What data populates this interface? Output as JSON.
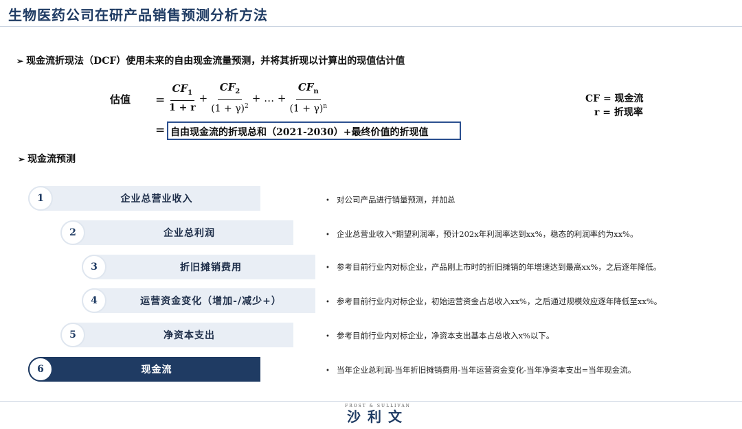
{
  "title": "生物医药公司在研产品销售预测分析方法",
  "bullets": {
    "dcf": "现金流折现法（DCF）使用未来的自由现金流量预测，并将其折现以计算出的现值估计值",
    "forecast": "现金流预测",
    "arrow": "➢"
  },
  "formula": {
    "label": "估值",
    "eq": "=",
    "t1_num": "CF",
    "t1_sub": "1",
    "t1_den": "1 + r",
    "plus": "+",
    "t2_num": "CF",
    "t2_sub": "2",
    "t2_den": "(1 + γ)",
    "t2_exp": "2",
    "ellipsis": "+ … +",
    "tn_num": "CF",
    "tn_sub": "n",
    "tn_den": "(1 + γ)",
    "tn_exp": "n",
    "boxed": "自由现金流的折现总和（2021-2030）+最终价值的折现值"
  },
  "legend": {
    "cf": "CF = 现金流",
    "r": "r = 折现率"
  },
  "steps": [
    {
      "num": "1",
      "label": "企业总营业收入",
      "desc": "对公司产品进行销量预测，并加总"
    },
    {
      "num": "2",
      "label": "企业总利润",
      "desc": "企业总营业收入*期望利润率，预计202x年利润率达到xx%，稳态的利润率约为xx%。"
    },
    {
      "num": "3",
      "label": "折旧摊销费用",
      "desc": "参考目前行业内对标企业，产品刚上市时的折旧摊销的年增速达到最高xx%，之后逐年降低。"
    },
    {
      "num": "4",
      "label": "运营资金变化（增加-/减少+）",
      "desc": "参考目前行业内对标企业，初始运营资金占总收入xx%，之后通过规模效应逐年降低至xx%。"
    },
    {
      "num": "5",
      "label": "净资本支出",
      "desc": "参考目前行业内对标企业，净资本支出基本占总收入x%以下。"
    },
    {
      "num": "6",
      "label": "现金流",
      "desc": "当年企业总利润-当年折旧摊销费用-当年运营资金变化-当年净资本支出=当年现金流。"
    }
  ],
  "bullet_dot": "•",
  "logo": {
    "en": "FROST & SULLIVAN",
    "cn": "沙利文"
  },
  "colors": {
    "navy": "#1f3b63",
    "bar": "#e9eef5",
    "box_border": "#2a4f8f"
  }
}
